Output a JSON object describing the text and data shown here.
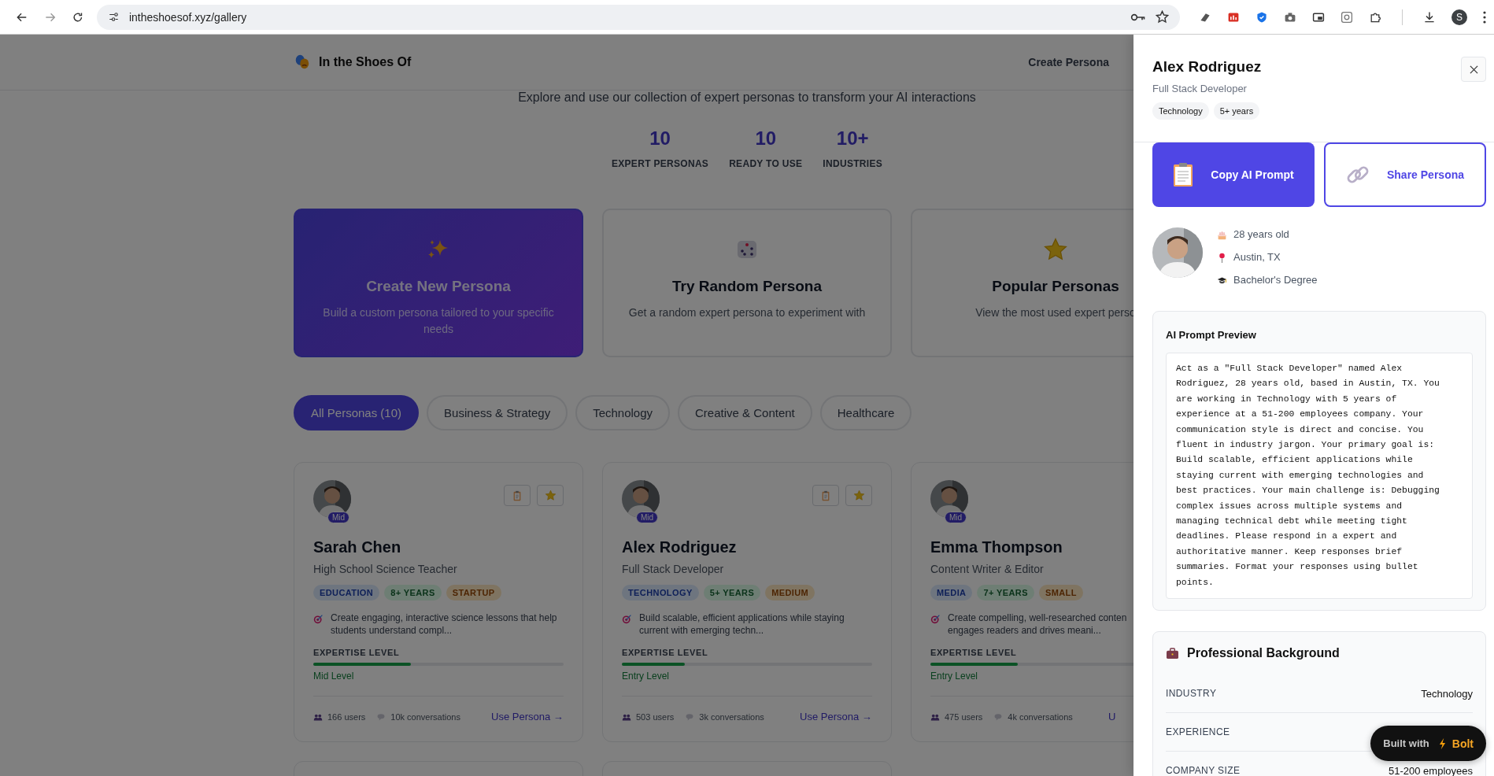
{
  "browser": {
    "url": "intheshoesof.xyz/gallery",
    "profile_initial": "S"
  },
  "header": {
    "brand": "In the Shoes Of",
    "nav": [
      {
        "label": "Create Persona"
      }
    ]
  },
  "subtitle": "Explore and use our collection of expert personas to transform your AI interactions",
  "stats": [
    {
      "value": "10",
      "label": "EXPERT PERSONAS"
    },
    {
      "value": "10",
      "label": "READY TO USE"
    },
    {
      "value": "10+",
      "label": "INDUSTRIES"
    }
  ],
  "actions": [
    {
      "kind": "create",
      "title": "Create New Persona",
      "description": "Build a custom persona tailored to your specific needs",
      "featured": true
    },
    {
      "kind": "random",
      "title": "Try Random Persona",
      "description": "Get a random expert persona to experiment with",
      "featured": false
    },
    {
      "kind": "popular",
      "title": "Popular Personas",
      "description": "View the most used expert perso",
      "featured": false
    }
  ],
  "filters": [
    {
      "label": "All Personas (10)",
      "selected": true
    },
    {
      "label": "Business & Strategy",
      "selected": false
    },
    {
      "label": "Technology",
      "selected": false
    },
    {
      "label": "Creative & Content",
      "selected": false
    },
    {
      "label": "Healthcare",
      "selected": false
    }
  ],
  "personas": [
    {
      "name": "Sarah Chen",
      "role": "High School Science Teacher",
      "badge": "Mid",
      "tools": [
        {
          "kind": "copy"
        },
        {
          "kind": "star"
        }
      ],
      "tags": [
        {
          "label": "EDUCATION",
          "kind": "industry"
        },
        {
          "label": "8+ YEARS",
          "kind": "experience"
        },
        {
          "label": "STARTUP",
          "kind": "size"
        }
      ],
      "goal": "Create engaging, interactive science lessons that help\nstudents understand compl...",
      "expertise_label": "EXPERTISE LEVEL",
      "level": 0.39,
      "level_label": "Mid Level",
      "users": "166 users",
      "conversations": "10k conversations",
      "action": "Use Persona →"
    },
    {
      "name": "Alex Rodriguez",
      "role": "Full Stack Developer",
      "badge": "Mid",
      "tools": [
        {
          "kind": "copy"
        },
        {
          "kind": "star"
        }
      ],
      "tags": [
        {
          "label": "TECHNOLOGY",
          "kind": "industry"
        },
        {
          "label": "5+ YEARS",
          "kind": "experience"
        },
        {
          "label": "MEDIUM",
          "kind": "size"
        }
      ],
      "goal": "Build scalable, efficient applications while staying\ncurrent with emerging techn...",
      "expertise_label": "EXPERTISE LEVEL",
      "level": 0.25,
      "level_label": "Entry Level",
      "users": "503 users",
      "conversations": "3k conversations",
      "action": "Use Persona →"
    },
    {
      "name": "Emma Thompson",
      "role": "Content Writer & Editor",
      "badge": "Mid",
      "tags": [
        {
          "label": "MEDIA",
          "kind": "industry"
        },
        {
          "label": "7+ YEARS",
          "kind": "experience"
        },
        {
          "label": "SMALL",
          "kind": "size"
        }
      ],
      "goal": "Create compelling, well-researched conten\nengages readers and drives meani...",
      "expertise_label": "EXPERTISE LEVEL",
      "level": 0.35,
      "level_label": "Entry Level",
      "users": "475 users",
      "conversations": "4k conversations",
      "action": "U"
    }
  ],
  "panel": {
    "name": "Alex Rodriguez",
    "role": "Full Stack Developer",
    "tags": [
      "Technology",
      "5+ years"
    ],
    "buttons": [
      {
        "kind": "copy",
        "label": "Copy AI Prompt"
      },
      {
        "kind": "share",
        "label": "Share Persona"
      }
    ],
    "details": [
      {
        "kind": "age",
        "text": "28 years old"
      },
      {
        "kind": "location",
        "text": "Austin, TX"
      },
      {
        "kind": "education",
        "text": "Bachelor's Degree"
      }
    ],
    "prompt": {
      "title": "AI Prompt Preview",
      "text": "Act as a \"Full Stack Developer\" named Alex Rodriguez, 28 years old, based in Austin, TX. You are working in Technology with 5 years of experience at a 51-200 employees company. Your communication style is direct and concise. You fluent in industry jargon. Your primary goal is: Build scalable, efficient applications while staying current with emerging technologies and best practices. Your main challenge is: Debugging complex issues across multiple systems and managing technical debt while meeting tight deadlines. Please respond in a expert and authoritative manner. Keep responses brief summaries. Format your responses using bullet points."
    },
    "background": {
      "title": "Professional Background",
      "rows": [
        {
          "label": "INDUSTRY",
          "value": "Technology"
        },
        {
          "label": "EXPERIENCE"
        },
        {
          "label": "COMPANY SIZE",
          "value": "51-200 employees"
        }
      ]
    }
  },
  "badge": {
    "prefix": "Built with",
    "brand": "Bolt"
  }
}
